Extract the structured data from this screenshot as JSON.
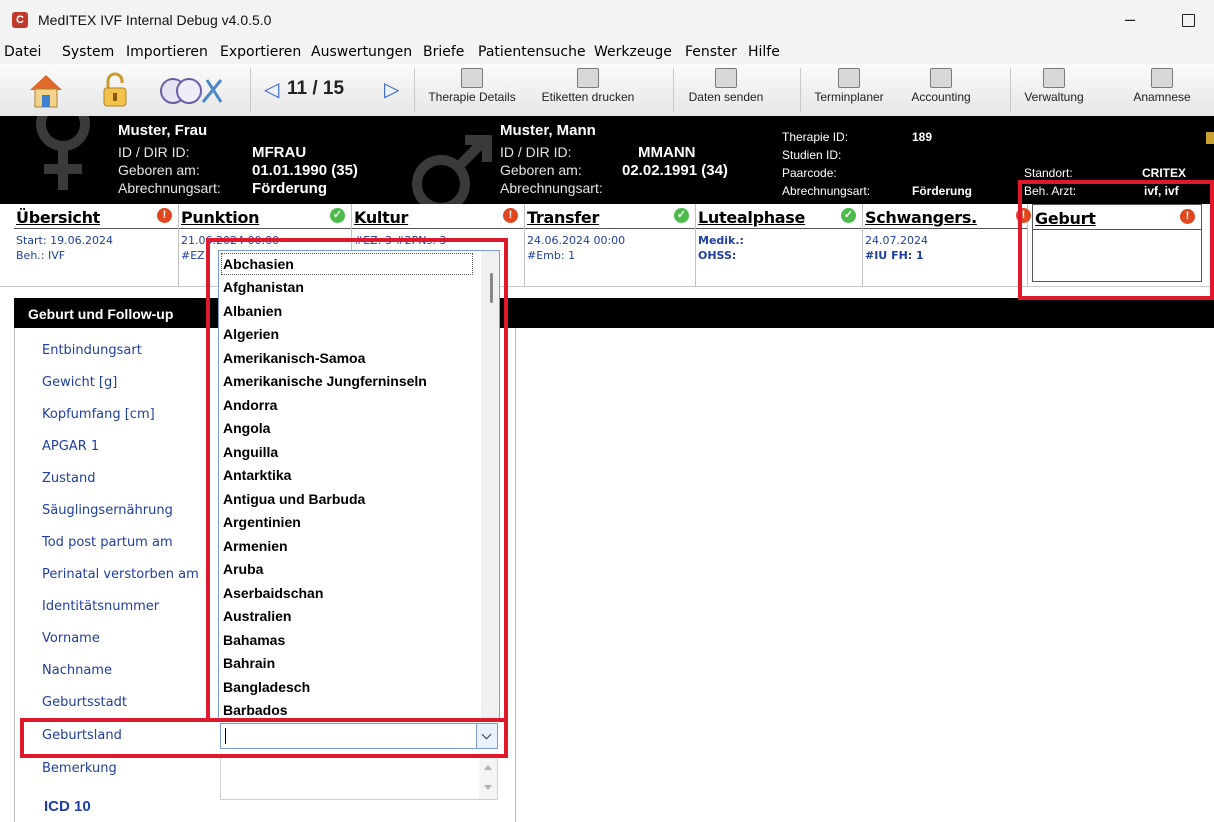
{
  "window": {
    "title": "MedITEX IVF Internal Debug v4.0.5.0",
    "minimize": "–"
  },
  "menu": [
    "Datei",
    "System",
    "Importieren",
    "Exportieren",
    "Auswertungen",
    "Briefe",
    "Patientensuche",
    "Werkzeuge",
    "Fenster",
    "Hilfe"
  ],
  "toolbar": {
    "page": "11 / 15",
    "buttons": [
      "Therapie Details",
      "Etiketten drucken",
      "Daten senden",
      "Terminplaner",
      "Accounting",
      "Verwaltung",
      "Anamnese"
    ],
    "prev": "◁",
    "next": "▷"
  },
  "female": {
    "name": "Muster, Frau",
    "id_label": "ID / DIR ID:",
    "id": "MFRAU",
    "birth_label": "Geboren am:",
    "birth": "01.01.1990  (35)",
    "billing_label": "Abrechnungsart:",
    "billing": "Förderung"
  },
  "male": {
    "name": "Muster, Mann",
    "id_label": "ID / DIR ID:",
    "id": "MMANN",
    "birth_label": "Geboren am:",
    "birth": "02.02.1991  (34)",
    "billing_label": "Abrechnungsart:"
  },
  "therapy": {
    "id_label": "Therapie ID:",
    "id": "189",
    "study_label": "Studien ID:",
    "pair_label": "Paarcode:",
    "billing_label": "Abrechnungsart:",
    "billing": "Förderung",
    "location_label": "Standort:",
    "location": "CRITEX",
    "doctor_label": "Beh. Arzt:",
    "doctor": "ivf, ivf"
  },
  "tabs": [
    {
      "title": "Übersicht",
      "status": "err",
      "d1": "Start: 19.06.2024",
      "d2": "Beh.: IVF"
    },
    {
      "title": "Punktion",
      "status": "ok",
      "d1": "21.06.2024 00:00",
      "d2": "#EZ"
    },
    {
      "title": "Kultur",
      "status": "err",
      "d1": "#EZ: 3 #2PNs: 3",
      "d2": ""
    },
    {
      "title": "Transfer",
      "status": "ok",
      "d1": "24.06.2024 00:00",
      "d2": "#Emb: 1"
    },
    {
      "title": "Lutealphase",
      "status": "ok",
      "d1": "Medik.:",
      "d2": "OHSS:"
    },
    {
      "title": "Schwangers.",
      "status": "err",
      "d1": "24.07.2024",
      "d2": "#IU FH:  1"
    },
    {
      "title": "Geburt",
      "status": "err",
      "d1": "",
      "d2": ""
    }
  ],
  "status_icons": {
    "ok": "✓",
    "err": "!"
  },
  "section": {
    "title": "Geburt und Follow-up"
  },
  "fields": [
    "Entbindungsart",
    "Gewicht [g]",
    "Kopfumfang [cm]",
    "APGAR 1",
    "Zustand",
    "Säuglingsernährung",
    "Tod post partum am",
    "Perinatal verstorben am",
    "Identitätsnummer",
    "Vorname",
    "Nachname",
    "Geburtsstadt",
    "Geburtsland",
    "Bemerkung"
  ],
  "icd": {
    "title": "ICD 10"
  },
  "countries": [
    "Abchasien",
    "Afghanistan",
    "Albanien",
    "Algerien",
    "Amerikanisch-Samoa",
    "Amerikanische Jungferninseln",
    "Andorra",
    "Angola",
    "Anguilla",
    "Antarktika",
    "Antigua und Barbuda",
    "Argentinien",
    "Armenien",
    "Aruba",
    "Aserbaidschan",
    "Australien",
    "Bahamas",
    "Bahrain",
    "Bangladesch",
    "Barbados"
  ],
  "colors": {
    "highlight": "#e0182b",
    "header_bg": "#000000",
    "label_blue": "#1f3f9f"
  }
}
